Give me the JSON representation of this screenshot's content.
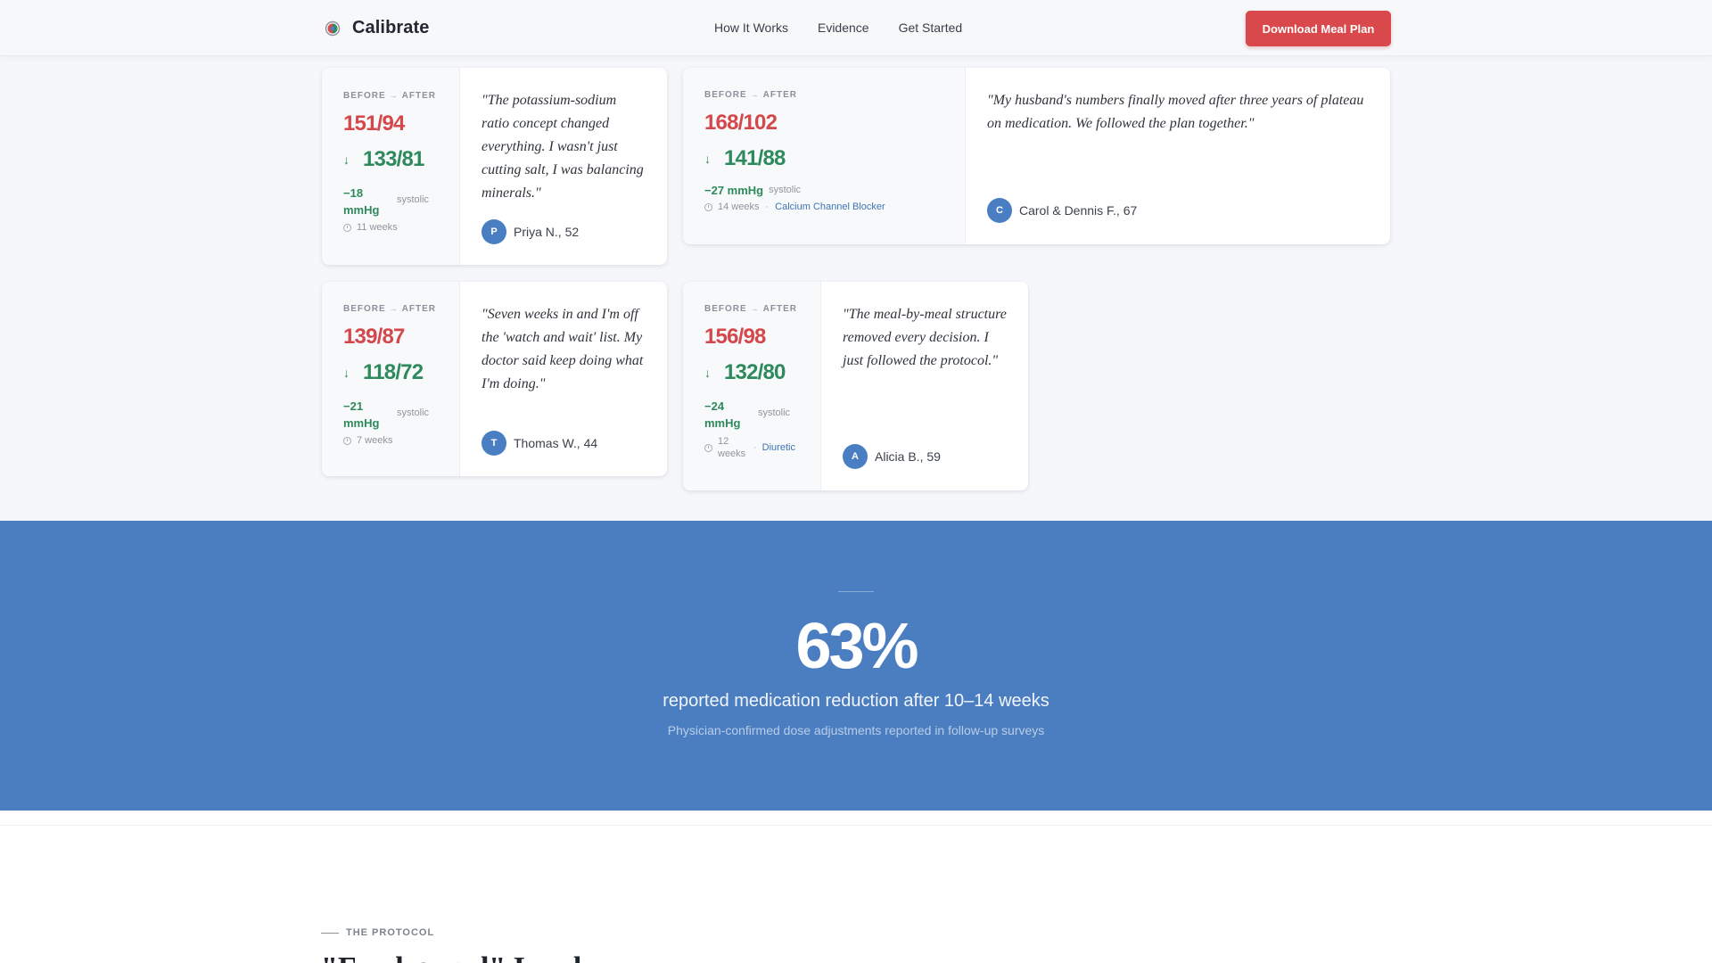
{
  "nav": {
    "brand": "Calibrate",
    "links": [
      "How It Works",
      "Evidence",
      "Get Started"
    ],
    "cta": "Download Meal Plan"
  },
  "cards": [
    {
      "before_label": "BEFORE",
      "after_label": "AFTER",
      "before": "151/94",
      "after": "133/81",
      "delta": "−18 mmHg",
      "delta_unit": "systolic",
      "duration": "11 weeks",
      "medication": "",
      "quote": "\"The potassium-sodium ratio concept changed everything. I wasn't just cutting salt, I was balancing minerals.\"",
      "initial": "P",
      "author": "Priya N., 52"
    },
    {
      "before_label": "BEFORE",
      "after_label": "AFTER",
      "before": "168/102",
      "after": "141/88",
      "delta": "−27 mmHg",
      "delta_unit": "systolic",
      "duration": "14 weeks",
      "medication": "Calcium Channel Blocker",
      "quote": "\"My husband's numbers finally moved after three years of plateau on medication. We followed the plan together.\"",
      "initial": "C",
      "author": "Carol & Dennis F., 67"
    },
    {
      "before_label": "BEFORE",
      "after_label": "AFTER",
      "before": "139/87",
      "after": "118/72",
      "delta": "−21 mmHg",
      "delta_unit": "systolic",
      "duration": "7 weeks",
      "medication": "",
      "quote": "\"Seven weeks in and I'm off the 'watch and wait' list. My doctor said keep doing what I'm doing.\"",
      "initial": "T",
      "author": "Thomas W., 44"
    },
    {
      "before_label": "BEFORE",
      "after_label": "AFTER",
      "before": "156/98",
      "after": "132/80",
      "delta": "−24 mmHg",
      "delta_unit": "systolic",
      "duration": "12 weeks",
      "medication": "Diuretic",
      "quote": "\"The meal-by-meal structure removed every decision. I just followed the protocol.\"",
      "initial": "A",
      "author": "Alicia B., 59"
    }
  ],
  "stat": {
    "value": "63%",
    "label": "reported medication reduction after 10–14 weeks",
    "sub": "Physician-confirmed dose adjustments reported in follow-up surveys"
  },
  "protocol": {
    "eyebrow": "THE PROTOCOL",
    "heading": "\"Food-pared\" I and"
  },
  "colors": {
    "accent_red": "#d9484a",
    "bp_red": "#d4484b",
    "bp_green": "#2e8a5c",
    "band_blue": "#4a7ec1",
    "avatar_blue": "#4a7ec2"
  },
  "icons": {
    "logo": "calibrate-logo-icon",
    "down": "arrow-down-icon",
    "clock": "clock-icon"
  }
}
